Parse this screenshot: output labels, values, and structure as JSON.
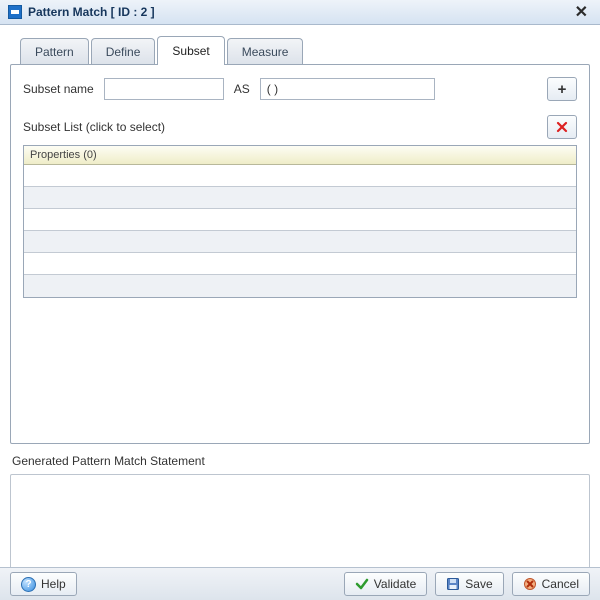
{
  "title": "Pattern Match [ ID : 2 ]",
  "tabs": {
    "pattern": "Pattern",
    "define": "Define",
    "subset": "Subset",
    "measure": "Measure"
  },
  "form": {
    "subset_name_label": "Subset name",
    "subset_name_value": "",
    "as_label": "AS",
    "as_value": "( )",
    "add_label": "+"
  },
  "subset_list_label": "Subset List (click to select)",
  "grid": {
    "header": "Properties (0)"
  },
  "generated_label": "Generated Pattern Match Statement",
  "footer": {
    "help": "Help",
    "validate": "Validate",
    "save": "Save",
    "cancel": "Cancel"
  }
}
